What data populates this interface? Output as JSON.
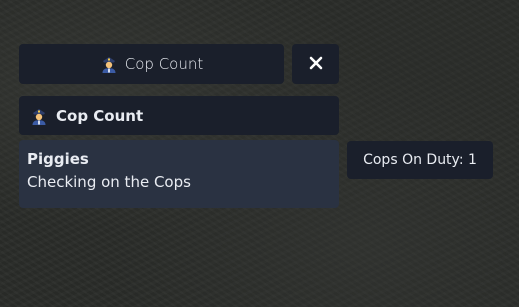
{
  "menu_header": {
    "title": "Cop Count",
    "icon": "police-officer-icon"
  },
  "close_button": {
    "icon": "close-icon"
  },
  "menu": {
    "header_title": "Cop Count",
    "header_icon": "police-officer-icon",
    "items": [
      {
        "title": "Piggies",
        "description": "Checking on the Cops"
      }
    ]
  },
  "info": {
    "label": "Cops On Duty: 1"
  },
  "colors": {
    "panel_bg": "#1a1f2b",
    "item_bg": "#2a3242",
    "text": "#e9ecf2"
  }
}
